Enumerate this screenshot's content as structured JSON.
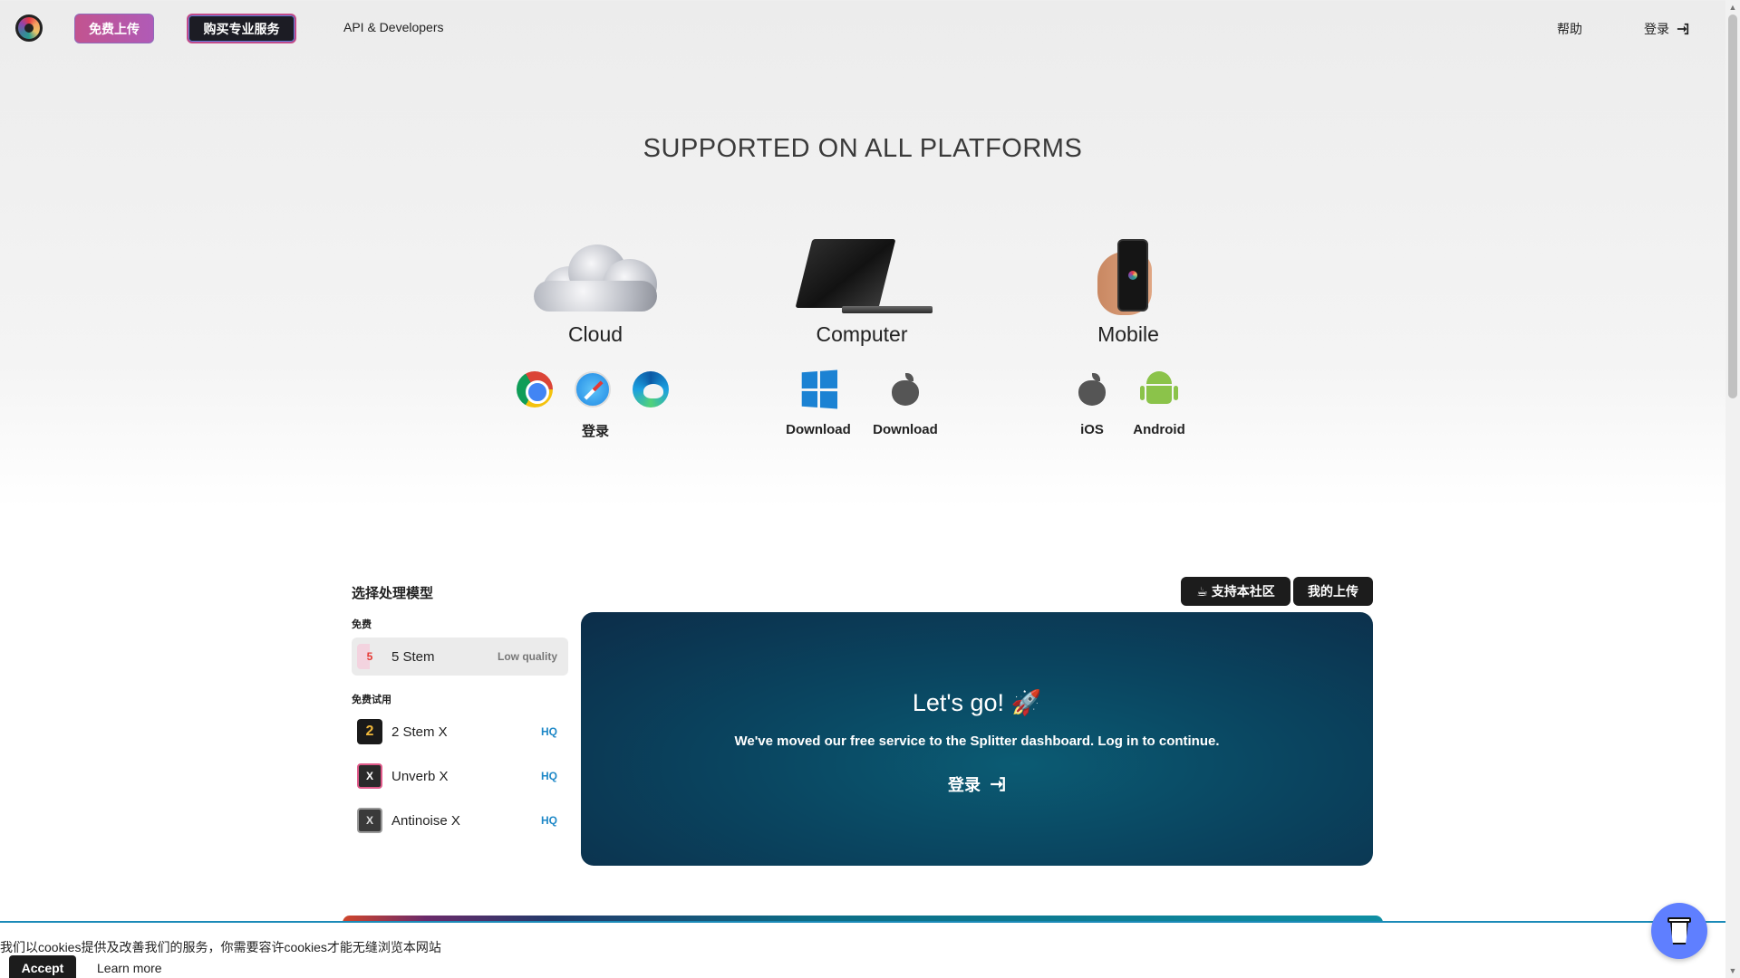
{
  "header": {
    "upload_label": "免费上传",
    "pro_label": "购买专业服务",
    "api_label": "API & Developers",
    "help_label": "帮助",
    "login_label": "登录"
  },
  "platforms": {
    "title": "SUPPORTED ON ALL PLATFORMS",
    "cloud": {
      "name": "Cloud",
      "login_label": "登录"
    },
    "computer": {
      "name": "Computer",
      "windows_label": "Download",
      "mac_label": "Download"
    },
    "mobile": {
      "name": "Mobile",
      "ios_label": "iOS",
      "android_label": "Android"
    }
  },
  "models": {
    "title": "选择处理模型",
    "community_label": "支持本社区",
    "my_uploads_label": "我的上传",
    "free_group": "免费",
    "trial_group": "免费试用",
    "items": [
      {
        "icon_text": "5",
        "name": "5 Stem",
        "badge": "Low quality"
      },
      {
        "icon_text": "2",
        "name": "2 Stem X",
        "badge": "HQ"
      },
      {
        "icon_text": "X",
        "name": "Unverb X",
        "badge": "HQ"
      },
      {
        "icon_text": "X",
        "name": "Antinoise X",
        "badge": "HQ"
      }
    ]
  },
  "panel": {
    "heading": "Let's go! 🚀",
    "message": "We've moved our free service to the Splitter dashboard. Log in to continue.",
    "login_label": "登录"
  },
  "cookie": {
    "text": "我们以cookies提供及改善我们的服务，你需要容许cookies才能无缝浏览本网站",
    "accept_label": "Accept",
    "learn_label": "Learn more"
  },
  "colors": {
    "accent_pink": "#c2538f",
    "panel_teal": "#0a4560",
    "hq_blue": "#1e88c7",
    "coffee_button": "#5f7fff"
  }
}
